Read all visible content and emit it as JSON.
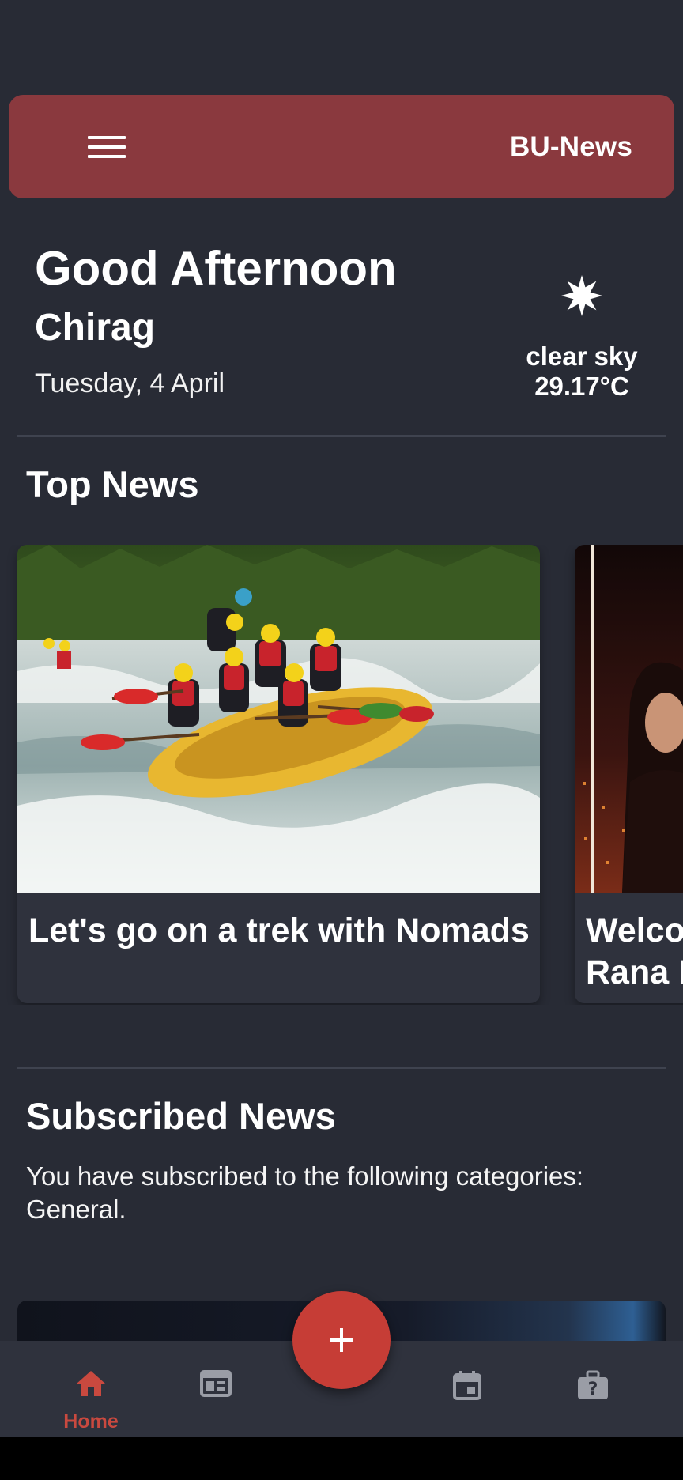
{
  "app_bar": {
    "title": "BU-News",
    "menu_icon": "hamburger-menu-icon"
  },
  "greeting": {
    "headline": "Good Afternoon",
    "name": "Chirag",
    "date": "Tuesday, 4 April"
  },
  "weather": {
    "icon": "sun-icon",
    "description": "clear sky",
    "temperature": "29.17°C"
  },
  "top_news": {
    "heading": "Top News",
    "cards": [
      {
        "title": "Let's go on a trek with Nomads",
        "image": "river-rafting-photo"
      },
      {
        "title_line1": "Welco",
        "title_line2": "Rana I",
        "image": "movie-poster-photo"
      }
    ]
  },
  "subscribed": {
    "heading": "Subscribed News",
    "text": "You have subscribed to the following categories: General."
  },
  "bottom_nav": {
    "items": [
      {
        "label": "Home",
        "icon": "home-icon",
        "active": true
      },
      {
        "icon": "newspaper-icon"
      },
      {
        "icon": "calendar-icon"
      },
      {
        "icon": "quiz-briefcase-icon"
      }
    ],
    "fab_icon": "plus-icon"
  },
  "colors": {
    "background": "#282b35",
    "app_bar": "#8a393e",
    "accent": "#c63d36",
    "active_nav": "#c9493f",
    "inactive_nav": "#9a9da6"
  }
}
